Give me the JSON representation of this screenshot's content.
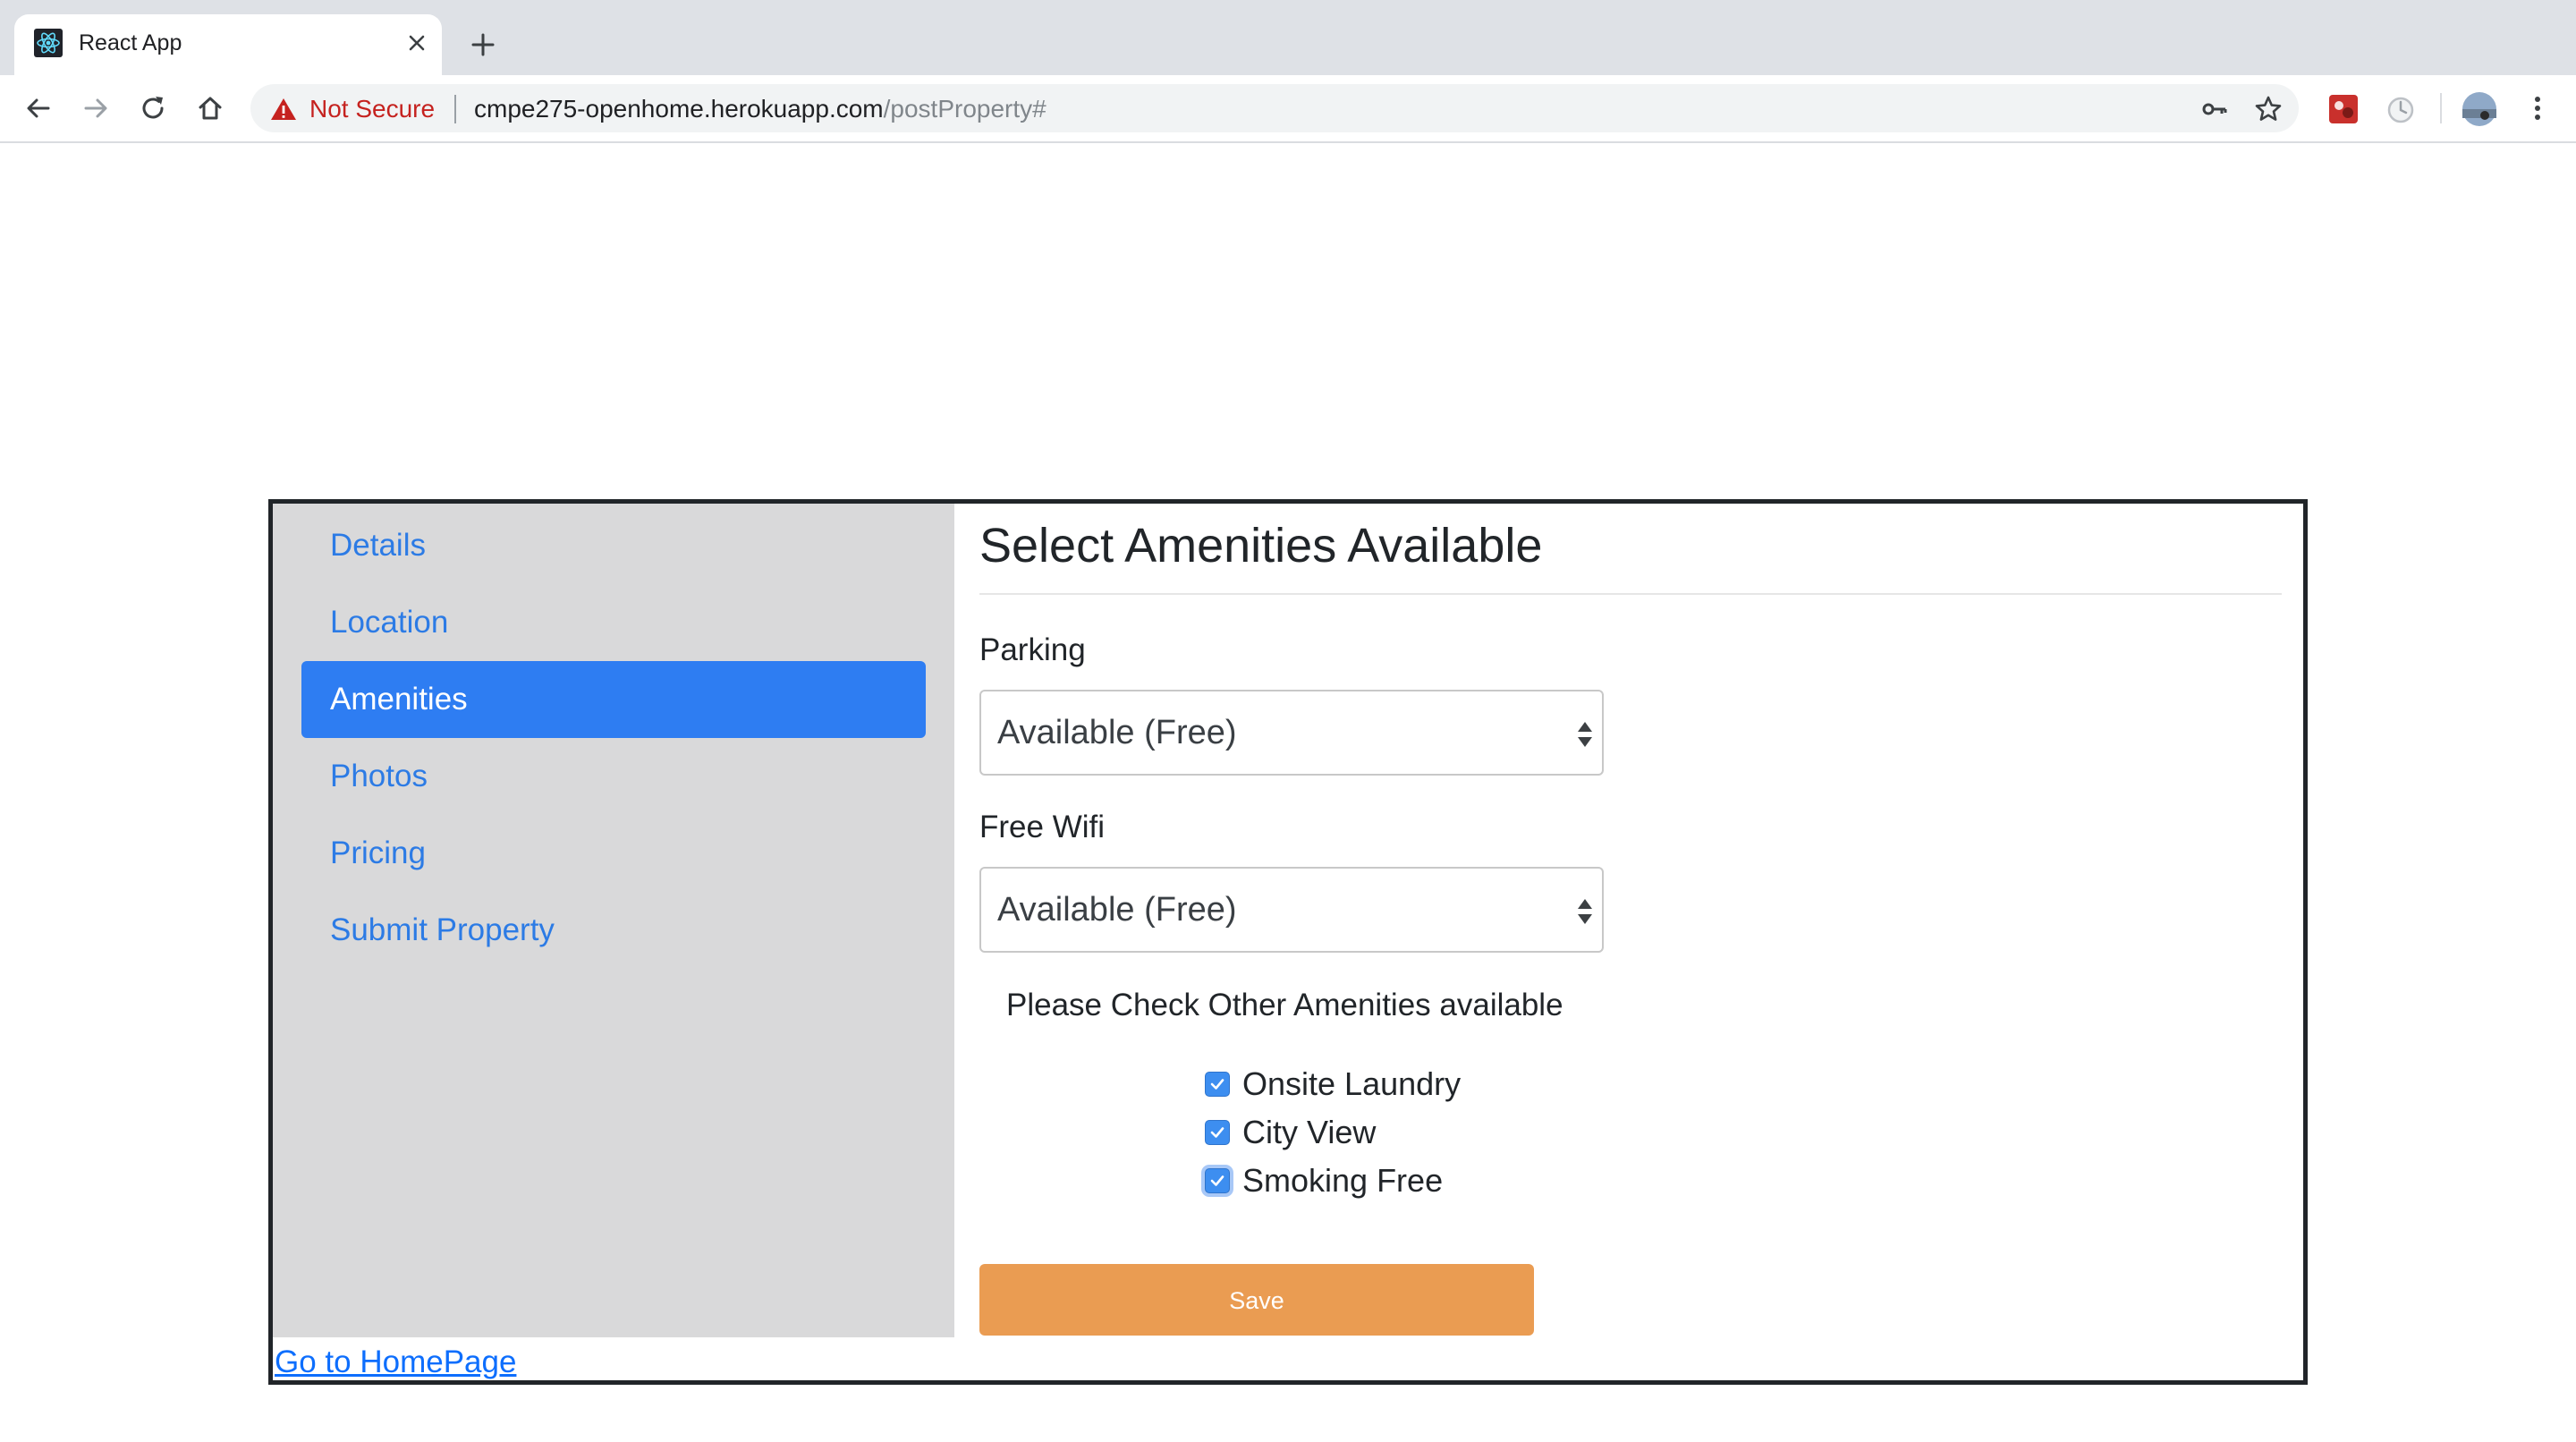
{
  "browser": {
    "tab": {
      "title": "React App",
      "favicon": "react-logo-icon"
    },
    "new_tab_icon": "plus-icon",
    "nav": {
      "back_icon": "back-arrow-icon",
      "forward_icon": "forward-arrow-icon",
      "reload_icon": "reload-icon",
      "home_icon": "home-icon"
    },
    "omnibox": {
      "security_label": "Not Secure",
      "url_host": "cmpe275-openhome.herokuapp.com",
      "url_path": "/postProperty#"
    }
  },
  "page": {
    "sidebar": {
      "items": [
        {
          "label": "Details",
          "active": false
        },
        {
          "label": "Location",
          "active": false
        },
        {
          "label": "Amenities",
          "active": true
        },
        {
          "label": "Photos",
          "active": false
        },
        {
          "label": "Pricing",
          "active": false
        },
        {
          "label": "Submit Property",
          "active": false
        }
      ]
    },
    "home_link": "Go to HomePage",
    "title": "Select Amenities Available",
    "parking": {
      "label": "Parking",
      "value": "Available (Free)"
    },
    "wifi": {
      "label": "Free Wifi",
      "value": "Available (Free)"
    },
    "amenities": {
      "title": "Please Check Other Amenities available",
      "options": [
        {
          "label": "Onsite Laundry",
          "checked": true
        },
        {
          "label": "City View",
          "checked": true
        },
        {
          "label": "Smoking Free",
          "checked": true
        }
      ]
    },
    "save_label": "Save"
  },
  "colors": {
    "accent": "#2e7df2",
    "link": "#2c7be5",
    "save_button": "#ea9c52",
    "sidebar_bg": "#d9d9da",
    "warning": "#c5221f"
  }
}
